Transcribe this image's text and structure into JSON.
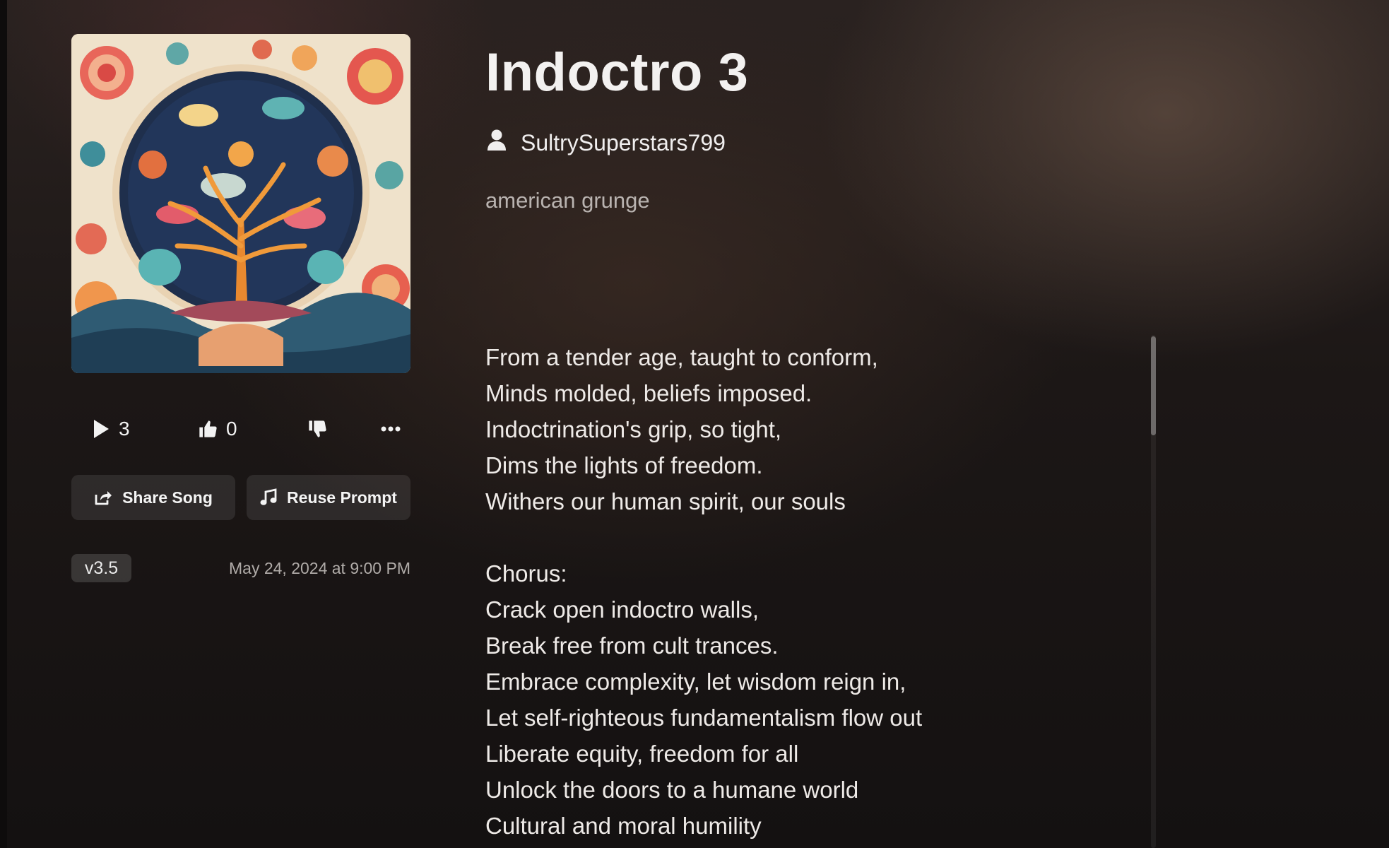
{
  "song": {
    "title": "Indoctro 3",
    "author": "SultrySuperstars799",
    "genre": "american grunge",
    "cover_alt": "colorful tree-of-life circular illustration"
  },
  "stats": {
    "plays": "3",
    "likes": "0"
  },
  "actions": {
    "share_label": "Share Song",
    "reuse_label": "Reuse Prompt"
  },
  "meta": {
    "version": "v3.5",
    "date": "May 24, 2024 at 9:00 PM"
  },
  "lyrics": {
    "verse": [
      "From a tender age, taught to conform,",
      "Minds molded, beliefs imposed.",
      "Indoctrination's grip, so tight,",
      "Dims the lights of freedom.",
      "Withers our human spirit, our souls"
    ],
    "chorus": [
      "Chorus:",
      "Crack open indoctro walls,",
      "Break free from cult trances.",
      "Embrace complexity, let wisdom reign in,",
      "Let self-righteous fundamentalism flow out",
      "Liberate equity, freedom for all",
      "Unlock the doors to a humane world",
      "Cultural and moral humility"
    ]
  },
  "icons": {
    "play": "play-icon",
    "like": "thumbs-up-icon",
    "dislike": "thumbs-down-icon",
    "more": "more-icon",
    "share": "share-icon",
    "reuse": "music-note-icon",
    "author": "user-icon"
  }
}
